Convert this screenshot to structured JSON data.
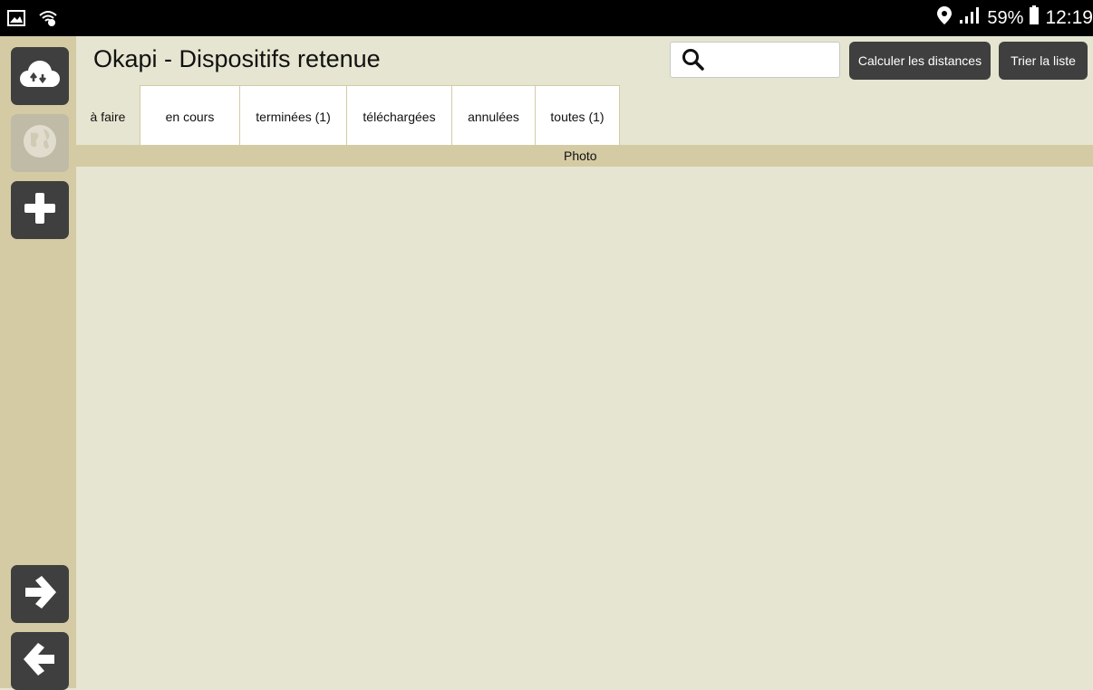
{
  "status_bar": {
    "battery": "59%",
    "time": "12:19",
    "icons": [
      "image-icon",
      "wifi-icon",
      "location-icon",
      "signal-icon",
      "battery-icon"
    ]
  },
  "sidebar": {
    "buttons": [
      {
        "name": "sync",
        "icon": "cloud-sync-icon",
        "enabled": true
      },
      {
        "name": "map",
        "icon": "globe-icon",
        "enabled": false
      },
      {
        "name": "add",
        "icon": "plus-icon",
        "enabled": true
      },
      {
        "name": "next",
        "icon": "arrow-right-icon",
        "enabled": true
      },
      {
        "name": "previous",
        "icon": "arrow-left-icon",
        "enabled": true
      }
    ]
  },
  "header": {
    "title": "Okapi - Dispositifs retenue",
    "search_value": "",
    "compute_distances_label": "Calculer les distances",
    "sort_list_label": "Trier la liste"
  },
  "tabs": [
    {
      "label": "à faire",
      "active": true
    },
    {
      "label": "en cours",
      "active": false
    },
    {
      "label": "terminées (1)",
      "active": false
    },
    {
      "label": "téléchargées",
      "active": false
    },
    {
      "label": "annulées",
      "active": false
    },
    {
      "label": "toutes (1)",
      "active": false
    }
  ],
  "table": {
    "columns": [
      "Photo"
    ]
  },
  "colors": {
    "background": "#e5e5d1",
    "sidebar": "#d4cba4",
    "button": "#3f3f3f"
  }
}
